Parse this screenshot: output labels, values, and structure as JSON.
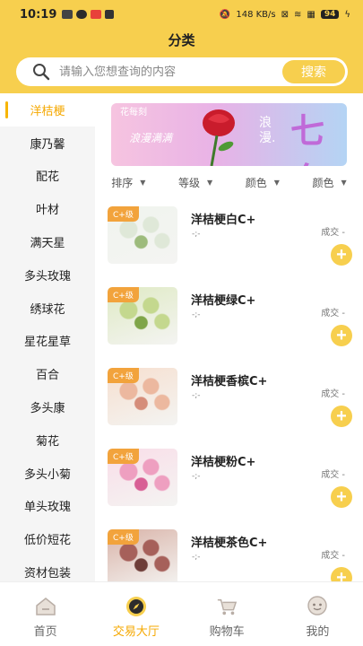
{
  "status_bar": {
    "time": "10:19",
    "network_speed": "148 KB/s",
    "battery": "94"
  },
  "header": {
    "title": "分类"
  },
  "search": {
    "placeholder": "请输入您想查询的内容",
    "button_label": "搜索"
  },
  "sidebar": {
    "items": [
      {
        "label": "洋桔梗",
        "active": true
      },
      {
        "label": "康乃馨"
      },
      {
        "label": "配花"
      },
      {
        "label": "叶材"
      },
      {
        "label": "满天星"
      },
      {
        "label": "多头玫瑰"
      },
      {
        "label": "绣球花"
      },
      {
        "label": "星花星草"
      },
      {
        "label": "百合"
      },
      {
        "label": "多头康"
      },
      {
        "label": "菊花"
      },
      {
        "label": "多头小菊"
      },
      {
        "label": "单头玫瑰"
      },
      {
        "label": "低价短花"
      },
      {
        "label": "资材包装"
      }
    ]
  },
  "banner": {
    "brand": "花每刻",
    "text": "浪漫满满",
    "right_text_1": "浪",
    "right_text_2": "漫.",
    "big_text": "七夕",
    "colors": {
      "left": "#f6c4e0",
      "right": "#b4d4f4"
    }
  },
  "filters": [
    "排序",
    "等级",
    "颜色",
    "颜色"
  ],
  "products": [
    {
      "name": "洋桔梗白C+",
      "grade": "C+级",
      "meta": "-;-",
      "sold": "成交 -",
      "colors": [
        "#f0f4ee",
        "#dfe8d8",
        "#9dbb7c"
      ]
    },
    {
      "name": "洋桔梗绿C+",
      "grade": "C+级",
      "meta": "-;-",
      "sold": "成交 -",
      "colors": [
        "#dfeac4",
        "#c4d88e",
        "#7fa548"
      ]
    },
    {
      "name": "洋桔梗香槟C+",
      "grade": "C+级",
      "meta": "-;-",
      "sold": "成交 -",
      "colors": [
        "#f6dfcf",
        "#ecb89f",
        "#d58d7a"
      ]
    },
    {
      "name": "洋桔梗粉C+",
      "grade": "C+级",
      "meta": "-;-",
      "sold": "成交 -",
      "colors": [
        "#f9dde8",
        "#ee9fc0",
        "#d85f95"
      ]
    },
    {
      "name": "洋桔梗茶色C+",
      "grade": "C+级",
      "meta": "-;-",
      "sold": "成交 -",
      "colors": [
        "#d9b3a8",
        "#a6605a",
        "#6e3d38"
      ]
    }
  ],
  "tabbar": {
    "items": [
      {
        "label": "首页",
        "icon": "home-icon"
      },
      {
        "label": "交易大厅",
        "icon": "compass-icon",
        "active": true
      },
      {
        "label": "购物车",
        "icon": "cart-icon"
      },
      {
        "label": "我的",
        "icon": "profile-icon"
      }
    ]
  },
  "theme": {
    "accent": "#f7cf4e",
    "active_text": "#f5a800",
    "badge": "#f2a33c"
  }
}
